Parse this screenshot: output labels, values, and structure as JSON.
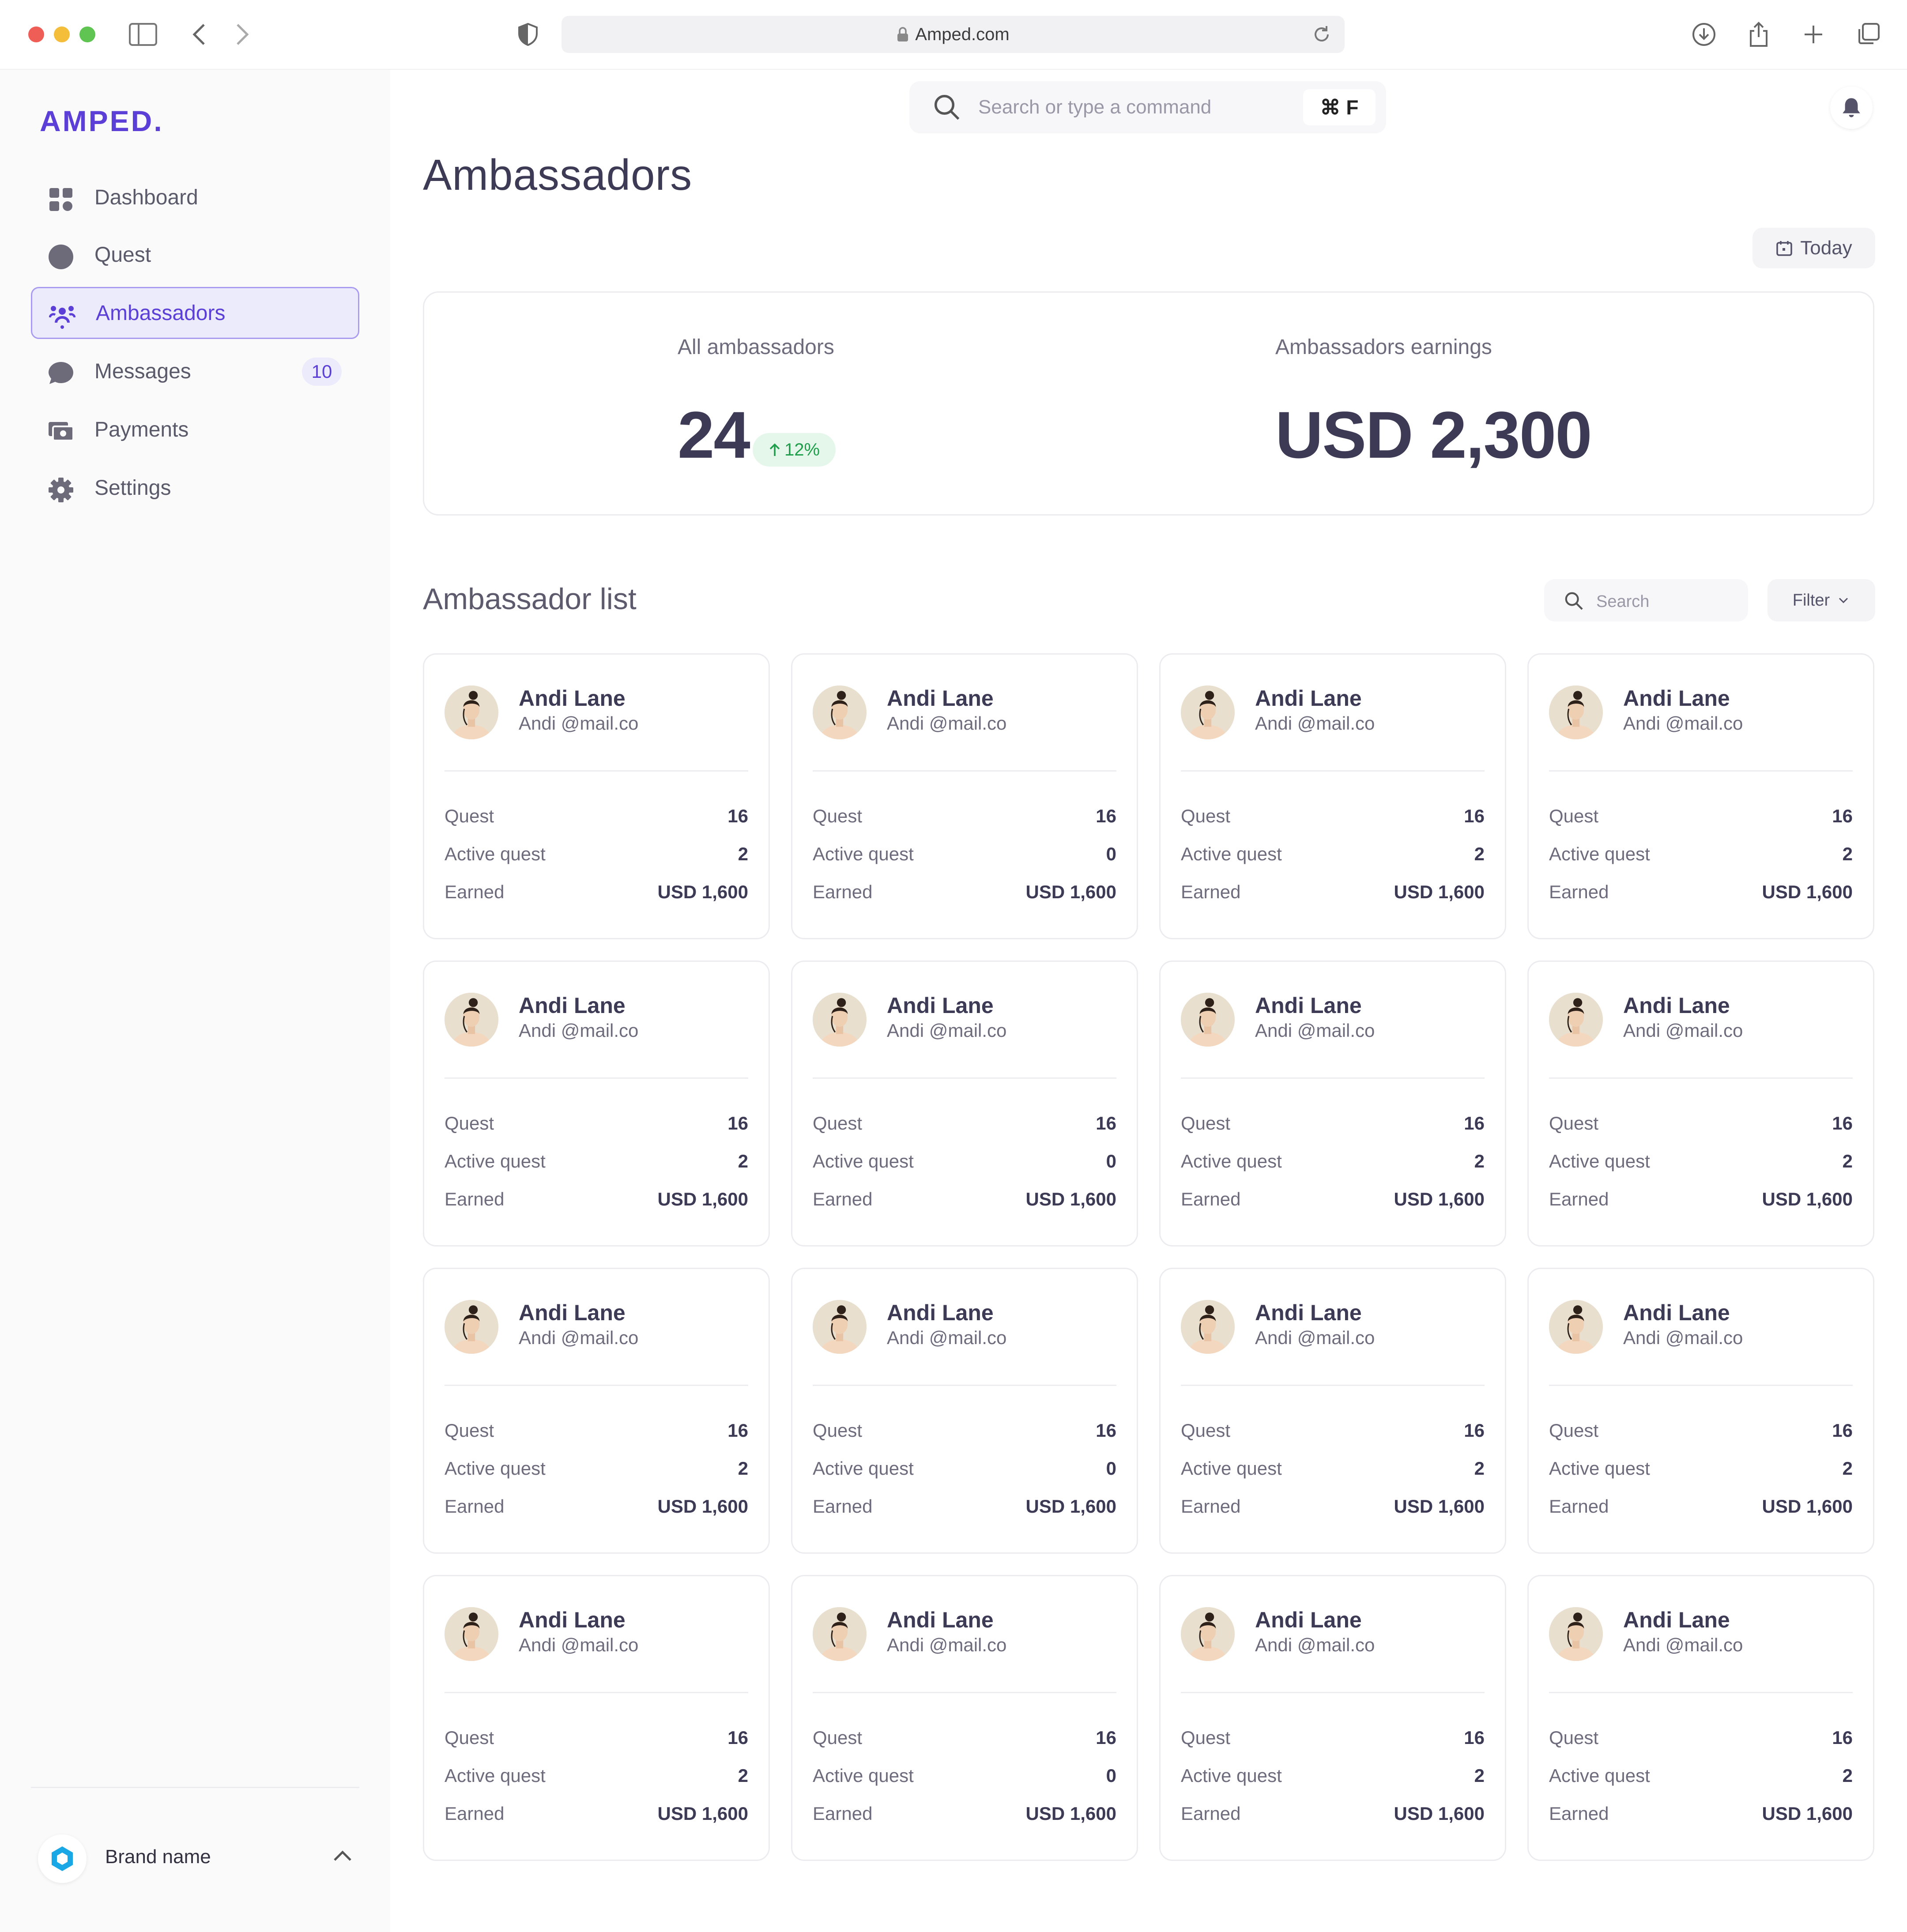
{
  "browser": {
    "url": "Amped.com"
  },
  "sidebar": {
    "logo": "AMPED.",
    "items": [
      {
        "label": "Dashboard",
        "icon": "grid-icon"
      },
      {
        "label": "Quest",
        "icon": "circle-icon"
      },
      {
        "label": "Ambassadors",
        "icon": "people-icon",
        "active": true
      },
      {
        "label": "Messages",
        "icon": "chat-icon",
        "badge": "10"
      },
      {
        "label": "Payments",
        "icon": "card-icon"
      },
      {
        "label": "Settings",
        "icon": "gear-icon"
      }
    ],
    "brand_name": "Brand name"
  },
  "header": {
    "search_placeholder": "Search or type a command",
    "shortcut": "⌘ F"
  },
  "page": {
    "title": "Ambassadors",
    "date_filter": "Today"
  },
  "stats": {
    "all_label": "All ambassadors",
    "all_value": "24",
    "all_trend": "12%",
    "earnings_label": "Ambassadors earnings",
    "earnings_value": "USD 2,300"
  },
  "list": {
    "title": "Ambassador list",
    "search_placeholder": "Search",
    "filter_label": "Filter",
    "field_labels": {
      "quest": "Quest",
      "active": "Active quest",
      "earned": "Earned"
    },
    "cards": [
      {
        "name": "Andi Lane",
        "email": "Andi @mail.co",
        "quest": "16",
        "active": "2",
        "earned": "USD 1,600"
      },
      {
        "name": "Andi Lane",
        "email": "Andi @mail.co",
        "quest": "16",
        "active": "0",
        "earned": "USD 1,600"
      },
      {
        "name": "Andi Lane",
        "email": "Andi @mail.co",
        "quest": "16",
        "active": "2",
        "earned": "USD 1,600"
      },
      {
        "name": "Andi Lane",
        "email": "Andi @mail.co",
        "quest": "16",
        "active": "2",
        "earned": "USD 1,600"
      },
      {
        "name": "Andi Lane",
        "email": "Andi @mail.co",
        "quest": "16",
        "active": "2",
        "earned": "USD 1,600"
      },
      {
        "name": "Andi Lane",
        "email": "Andi @mail.co",
        "quest": "16",
        "active": "0",
        "earned": "USD 1,600"
      },
      {
        "name": "Andi Lane",
        "email": "Andi @mail.co",
        "quest": "16",
        "active": "2",
        "earned": "USD 1,600"
      },
      {
        "name": "Andi Lane",
        "email": "Andi @mail.co",
        "quest": "16",
        "active": "2",
        "earned": "USD 1,600"
      },
      {
        "name": "Andi Lane",
        "email": "Andi @mail.co",
        "quest": "16",
        "active": "2",
        "earned": "USD 1,600"
      },
      {
        "name": "Andi Lane",
        "email": "Andi @mail.co",
        "quest": "16",
        "active": "0",
        "earned": "USD 1,600"
      },
      {
        "name": "Andi Lane",
        "email": "Andi @mail.co",
        "quest": "16",
        "active": "2",
        "earned": "USD 1,600"
      },
      {
        "name": "Andi Lane",
        "email": "Andi @mail.co",
        "quest": "16",
        "active": "2",
        "earned": "USD 1,600"
      },
      {
        "name": "Andi Lane",
        "email": "Andi @mail.co",
        "quest": "16",
        "active": "2",
        "earned": "USD 1,600"
      },
      {
        "name": "Andi Lane",
        "email": "Andi @mail.co",
        "quest": "16",
        "active": "0",
        "earned": "USD 1,600"
      },
      {
        "name": "Andi Lane",
        "email": "Andi @mail.co",
        "quest": "16",
        "active": "2",
        "earned": "USD 1,600"
      },
      {
        "name": "Andi Lane",
        "email": "Andi @mail.co",
        "quest": "16",
        "active": "2",
        "earned": "USD 1,600"
      }
    ]
  },
  "colors": {
    "accent": "#5b3fd6",
    "text_dark": "#3d3a56",
    "trend_green": "#1f9e4b"
  }
}
